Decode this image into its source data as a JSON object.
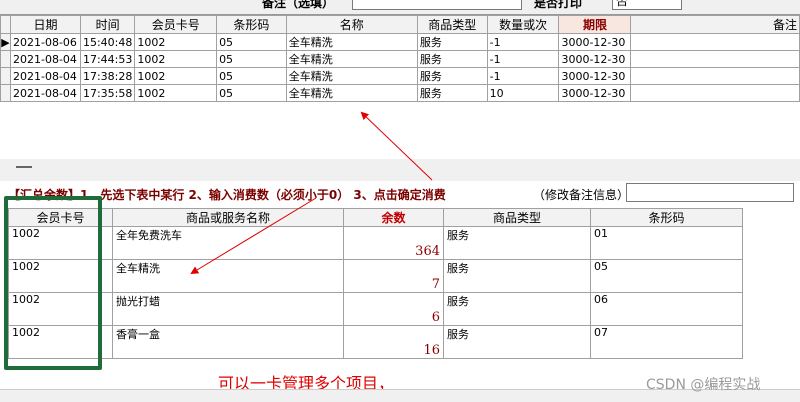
{
  "top_form": {
    "note_label": "备注（选填）",
    "print_label": "是否打印",
    "print_value": "否"
  },
  "grid1": {
    "headers": [
      "日期",
      "时间",
      "会员卡号",
      "条形码",
      "名称",
      "商品类型",
      "数量或次",
      "期限",
      "备注"
    ],
    "rows": [
      [
        "2021-08-06",
        "15:40:48",
        "1002",
        "05",
        "全车精洗",
        "服务",
        "-1",
        "3000-12-30",
        ""
      ],
      [
        "2021-08-04",
        "17:44:53",
        "1002",
        "05",
        "全车精洗",
        "服务",
        "-1",
        "3000-12-30",
        ""
      ],
      [
        "2021-08-04",
        "17:38:28",
        "1002",
        "05",
        "全车精洗",
        "服务",
        "-1",
        "3000-12-30",
        ""
      ],
      [
        "2021-08-04",
        "17:35:58",
        "1002",
        "05",
        "全车精洗",
        "服务",
        "10",
        "3000-12-30",
        ""
      ]
    ]
  },
  "instructions": {
    "text": "【汇总余数】1、先选下表中某行 2、输入消费数（必须小于0） 3、点击确定消费",
    "note_label": "（修改备注信息）",
    "note_value": ""
  },
  "grid2": {
    "headers": [
      "会员卡号",
      "商品或服务名称",
      "余数",
      "商品类型",
      "条形码"
    ],
    "rows": [
      [
        "1002",
        "全年免费洗车",
        "364",
        "服务",
        "01"
      ],
      [
        "1002",
        "全车精洗",
        "7",
        "服务",
        "05"
      ],
      [
        "1002",
        "抛光打蜡",
        "6",
        "服务",
        "06"
      ],
      [
        "1002",
        "香膏一盒",
        "16",
        "服务",
        "07"
      ]
    ]
  },
  "annotation": "可以一卡管理多个项目，",
  "watermark": "CSDN @编程实战",
  "colors": {
    "arrow": "#e00000",
    "highlight_box": "#1f6b3a",
    "instruction_text": "#7b0000"
  }
}
